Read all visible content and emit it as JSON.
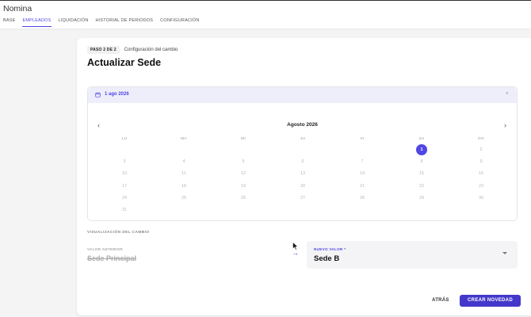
{
  "app": {
    "title": "Nomina"
  },
  "tabs": [
    {
      "label": "BASE",
      "active": false
    },
    {
      "label": "EMPLEADOS",
      "active": true
    },
    {
      "label": "LIQUIDACIÓN",
      "active": false
    },
    {
      "label": "HISTORIAL DE PERIODOS",
      "active": false
    },
    {
      "label": "CONFIGURACIÓN",
      "active": false
    }
  ],
  "step": {
    "badge": "PASO 2 DE 2",
    "label": "Configuración del cambio"
  },
  "page": {
    "title": "Actualizar Sede"
  },
  "date_field": {
    "value": "1 ago 2026",
    "icon": "calendar-icon",
    "clear_icon": "close-icon",
    "clear_glyph": "×"
  },
  "calendar": {
    "month_label": "Agosto 2026",
    "prev_glyph": "‹",
    "next_glyph": "›",
    "weekdays": [
      "LU",
      "MA",
      "MI",
      "JU",
      "VI",
      "SA",
      "DO"
    ],
    "first_weekday_index": 5,
    "days_in_month": 31,
    "selected_day": 1
  },
  "visualization": {
    "label": "VISUALIZACIÓN DEL CAMBIO",
    "old_label": "VALOR ANTERIOR",
    "old_value": "Sede Principal",
    "arrow_glyph": "→",
    "new_label": "NUEVO VALOR *",
    "new_value": "Sede B"
  },
  "actions": {
    "back_label": "ATRÁS",
    "create_label": "CREAR NOVEDAD"
  },
  "colors": {
    "accent": "#4f46e5",
    "accent_dark": "#4338ca",
    "muted": "#b9b9c0"
  }
}
